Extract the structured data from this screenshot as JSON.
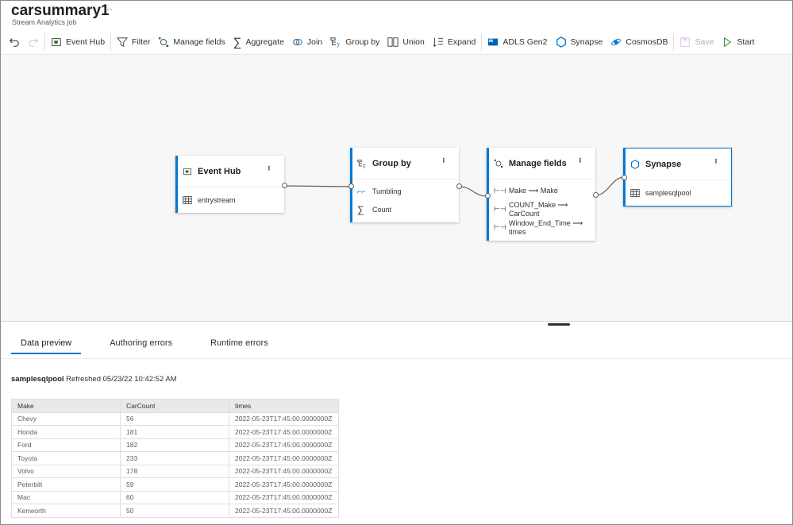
{
  "header": {
    "title": "carsummary1",
    "more": "···",
    "subtitle": "Stream Analytics job"
  },
  "toolbar": {
    "items": [
      {
        "label": "Event Hub",
        "icon": "event-hub-icon"
      },
      {
        "label": "Filter",
        "icon": "filter-icon"
      },
      {
        "label": "Manage fields",
        "icon": "manage-fields-icon"
      },
      {
        "label": "Aggregate",
        "icon": "sigma-icon"
      },
      {
        "label": "Join",
        "icon": "join-icon"
      },
      {
        "label": "Group by",
        "icon": "group-by-icon"
      },
      {
        "label": "Union",
        "icon": "union-icon"
      },
      {
        "label": "Expand",
        "icon": "expand-icon"
      },
      {
        "label": "ADLS Gen2",
        "icon": "adls-icon"
      },
      {
        "label": "Synapse",
        "icon": "synapse-icon"
      },
      {
        "label": "CosmosDB",
        "icon": "cosmosdb-icon"
      },
      {
        "label": "Save",
        "icon": "save-icon",
        "disabled": true
      },
      {
        "label": "Start",
        "icon": "play-icon"
      }
    ]
  },
  "nodes": {
    "eventhub": {
      "title": "Event Hub",
      "rows": [
        "entrystream"
      ]
    },
    "groupby": {
      "title": "Group by",
      "rows": [
        "Tumbling",
        "Count"
      ]
    },
    "manage": {
      "title": "Manage fields",
      "rows": [
        "Make ⟶ Make",
        "COUNT_Make ⟶ CarCount",
        "Window_End_Time ⟶ times"
      ]
    },
    "synapse": {
      "title": "Synapse",
      "rows": [
        "samplesqlpool"
      ]
    }
  },
  "tabs": [
    "Data preview",
    "Authoring errors",
    "Runtime errors"
  ],
  "preview": {
    "source": "samplesqlpool",
    "refreshed": "Refreshed 05/23/22 10:42:52 AM",
    "columns": [
      "Make",
      "CarCount",
      "times"
    ],
    "rows": [
      [
        "Chevy",
        "56",
        "2022-05-23T17:45:00.0000000Z"
      ],
      [
        "Honda",
        "181",
        "2022-05-23T17:45:00.0000000Z"
      ],
      [
        "Ford",
        "182",
        "2022-05-23T17:45:00.0000000Z"
      ],
      [
        "Toyota",
        "233",
        "2022-05-23T17:45:00.0000000Z"
      ],
      [
        "Volvo",
        "178",
        "2022-05-23T17:45:00.0000000Z"
      ],
      [
        "Peterbilt",
        "59",
        "2022-05-23T17:45:00.0000000Z"
      ],
      [
        "Mac",
        "60",
        "2022-05-23T17:45:00.0000000Z"
      ],
      [
        "Kenworth",
        "50",
        "2022-05-23T17:45:00.0000000Z"
      ]
    ]
  },
  "colors": {
    "accent": "#0078d4",
    "start": "#107c10"
  }
}
